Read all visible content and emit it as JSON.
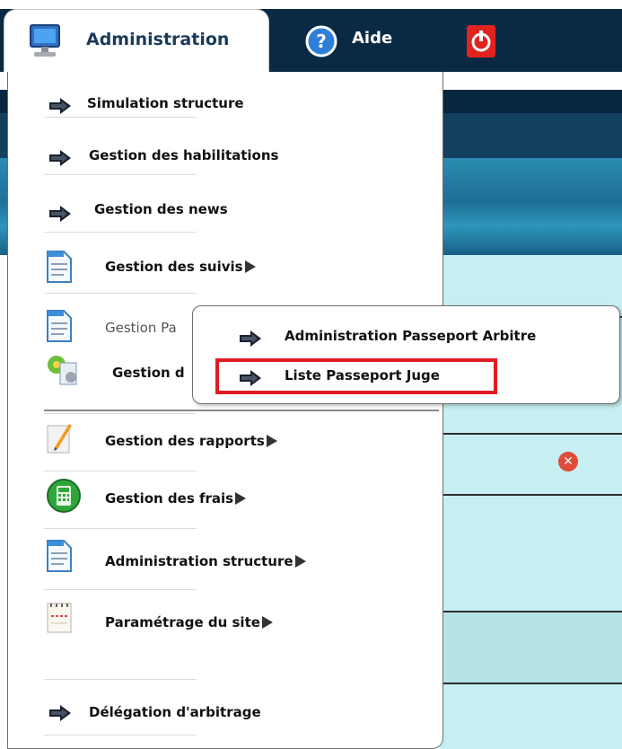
{
  "topbar": {
    "admin_label": "Administration",
    "help_label": "Aide",
    "icons": {
      "admin": "monitor-icon",
      "help": "question-circle-icon",
      "power": "power-icon"
    }
  },
  "menu": {
    "items": [
      {
        "label": "Simulation structure",
        "icon": "arrow-right-icon",
        "submenu": false
      },
      {
        "label": "Gestion des habilitations",
        "icon": "arrow-right-icon",
        "submenu": false
      },
      {
        "label": "Gestion des news",
        "icon": "arrow-right-icon",
        "submenu": false
      },
      {
        "label": "Gestion des suivis",
        "icon": "document-icon",
        "submenu": true
      },
      {
        "label": "Gestion Pa",
        "icon": "document-icon",
        "submenu": true,
        "active": true
      },
      {
        "label": "Gestion d",
        "icon": "tools-icon",
        "submenu": true
      },
      {
        "label": "Gestion des rapports",
        "icon": "notepad-pencil-icon",
        "submenu": true
      },
      {
        "label": "Gestion des frais",
        "icon": "calculator-icon",
        "submenu": true
      },
      {
        "label": "Administration structure",
        "icon": "document-icon",
        "submenu": true
      },
      {
        "label": "Paramétrage du site",
        "icon": "notepad-icon",
        "submenu": true
      },
      {
        "label": "Délégation d'arbitrage",
        "icon": "arrow-right-icon",
        "submenu": false
      }
    ]
  },
  "submenu": {
    "items": [
      {
        "label": "Administration Passeport Arbitre",
        "icon": "arrow-right-icon"
      },
      {
        "label": "Liste Passeport Juge",
        "icon": "arrow-right-icon",
        "highlighted": true
      }
    ]
  },
  "colors": {
    "topbar_dark": "#0a2a44",
    "banner": "#1f6f96",
    "row_bg": "#c6eff2",
    "highlight_border": "#e21b23",
    "close_icon": "#e04b3a"
  }
}
